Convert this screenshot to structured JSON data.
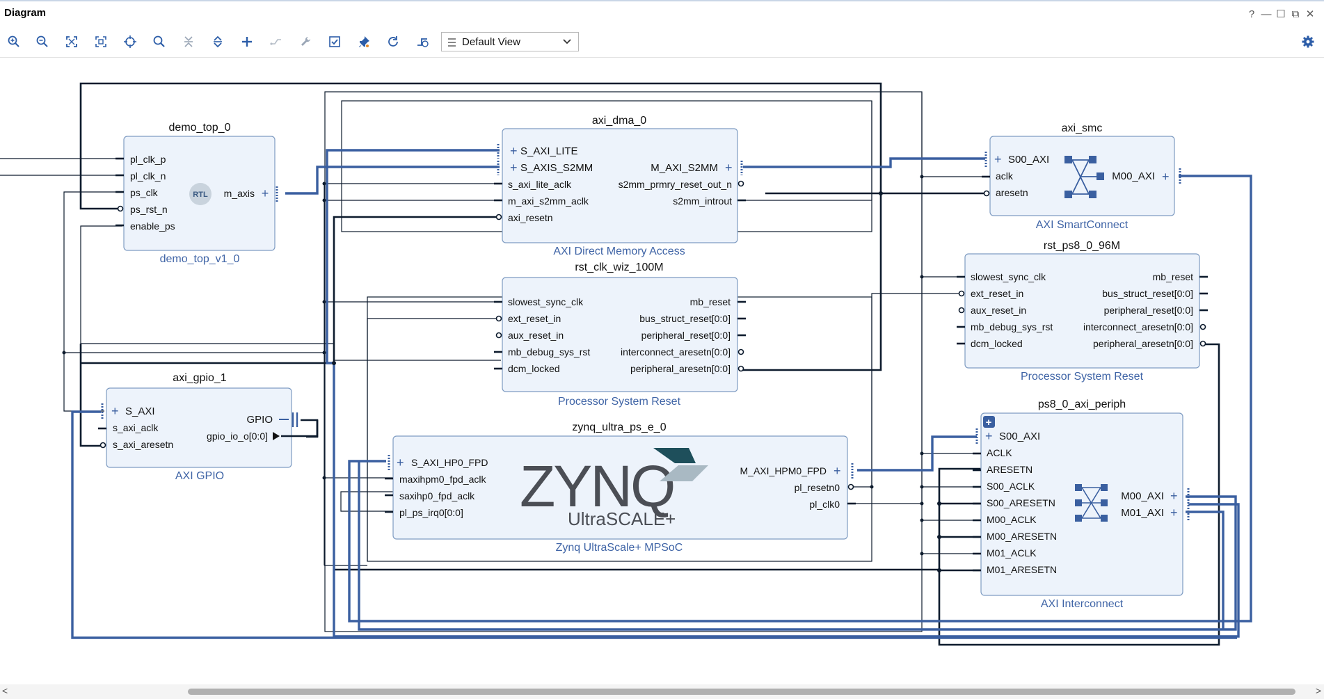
{
  "window": {
    "title": "Diagram",
    "controls": {
      "help": "?",
      "minimize": "—",
      "restore": "☐",
      "float": "⧉",
      "close": "✕"
    }
  },
  "toolbar": {
    "view_select_value": "Default View",
    "buttons": [
      "zoom-in-icon",
      "zoom-out-icon",
      "zoom-fit-icon",
      "zoom-selection-icon",
      "center-icon",
      "search-icon",
      "collapse-all-icon",
      "expand-all-icon",
      "add-ip-icon",
      "make-connection-icon",
      "wrench-icon",
      "validate-icon",
      "pin-icon",
      "refresh-icon",
      "auto-route-icon"
    ]
  },
  "blocks": {
    "demo_top": {
      "instance": "demo_top_0",
      "type": "demo_top_v1_0",
      "rtl": "RTL",
      "left_ports": [
        "pl_clk_p",
        "pl_clk_n",
        "ps_clk",
        "ps_rst_n",
        "enable_ps"
      ],
      "right_ports": [
        "m_axis"
      ]
    },
    "axi_dma": {
      "instance": "axi_dma_0",
      "type": "AXI Direct Memory Access",
      "left_ports": [
        "S_AXI_LITE",
        "S_AXIS_S2MM",
        "s_axi_lite_aclk",
        "m_axi_s2mm_aclk",
        "axi_resetn"
      ],
      "right_ports": [
        "M_AXI_S2MM",
        "s2mm_prmry_reset_out_n",
        "s2mm_introut"
      ]
    },
    "rst_clk": {
      "instance": "rst_clk_wiz_100M",
      "type": "Processor System Reset",
      "left_ports": [
        "slowest_sync_clk",
        "ext_reset_in",
        "aux_reset_in",
        "mb_debug_sys_rst",
        "dcm_locked"
      ],
      "right_ports": [
        "mb_reset",
        "bus_struct_reset[0:0]",
        "peripheral_reset[0:0]",
        "interconnect_aresetn[0:0]",
        "peripheral_aresetn[0:0]"
      ]
    },
    "zynq": {
      "instance": "zynq_ultra_ps_e_0",
      "type": "Zynq UltraScale+ MPSoC",
      "logo_main": "ZYNQ",
      "logo_sub": "UltraSCALE+",
      "left_ports": [
        "S_AXI_HP0_FPD",
        "maxihpm0_fpd_aclk",
        "saxihp0_fpd_aclk",
        "pl_ps_irq0[0:0]"
      ],
      "right_ports": [
        "M_AXI_HPM0_FPD",
        "pl_resetn0",
        "pl_clk0"
      ]
    },
    "axi_gpio": {
      "instance": "axi_gpio_1",
      "type": "AXI GPIO",
      "left_ports": [
        "S_AXI",
        "s_axi_aclk",
        "s_axi_aresetn"
      ],
      "right_ports": [
        "GPIO",
        "gpio_io_o[0:0]"
      ]
    },
    "axi_smc": {
      "instance": "axi_smc",
      "type": "AXI SmartConnect",
      "left_ports": [
        "S00_AXI",
        "aclk",
        "aresetn"
      ],
      "right_ports": [
        "M00_AXI"
      ]
    },
    "rst_ps8": {
      "instance": "rst_ps8_0_96M",
      "type": "Processor System Reset",
      "left_ports": [
        "slowest_sync_clk",
        "ext_reset_in",
        "aux_reset_in",
        "mb_debug_sys_rst",
        "dcm_locked"
      ],
      "right_ports": [
        "mb_reset",
        "bus_struct_reset[0:0]",
        "peripheral_reset[0:0]",
        "interconnect_aresetn[0:0]",
        "peripheral_aresetn[0:0]"
      ]
    },
    "periph": {
      "instance": "ps8_0_axi_periph",
      "type": "AXI Interconnect",
      "left_ports": [
        "S00_AXI",
        "ACLK",
        "ARESETN",
        "S00_ACLK",
        "S00_ARESETN",
        "M00_ACLK",
        "M00_ARESETN",
        "M01_ACLK",
        "M01_ARESETN"
      ],
      "right_ports": [
        "M00_AXI",
        "M01_AXI"
      ]
    }
  },
  "colors": {
    "block_fill": "#edf3fb",
    "block_border": "#7f9cc2",
    "bus": "#3a5fa0",
    "net": "#0d1b2d",
    "type_label": "#3f64a6",
    "logo_dark": "#4b4e55",
    "logo_teal": "#1e4f5b",
    "logo_light": "#a9b9c3"
  }
}
